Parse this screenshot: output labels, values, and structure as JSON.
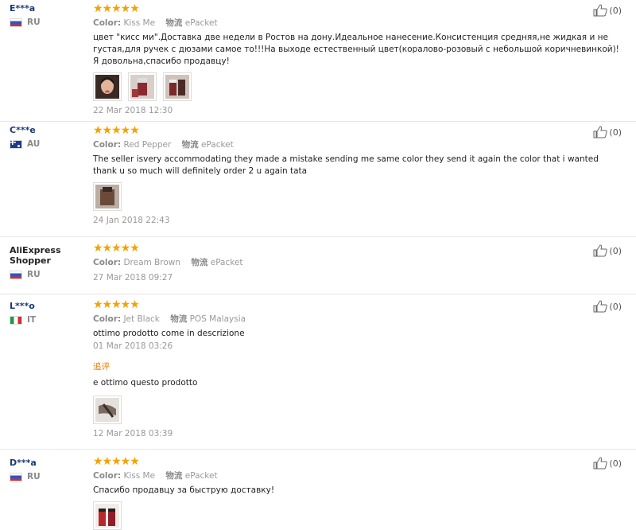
{
  "labels": {
    "color": "Color:",
    "shipping": "物流",
    "additional": "追评"
  },
  "reviews": [
    {
      "user": "E***a",
      "country": "RU",
      "stars": "★★★★★",
      "color": "Kiss Me",
      "shipping": "ePacket",
      "text": "цвет \"кисс ми\".Доставка две недели в Ростов на дону.Идеальное нанесение.Консистенция средняя,не жидкая и не густая,для ручек с дюзами самое то!!!На выходе естественный цвет(коралово-розовый с небольшой коричневинкой)!Я довольна,спасибо продавцу!",
      "date": "22 Mar 2018 12:30",
      "helpful": "(0)"
    },
    {
      "user": "C***e",
      "country": "AU",
      "stars": "★★★★★",
      "color": "Red Pepper",
      "shipping": "ePacket",
      "text": "The seller isvery accommodating they made a mistake sending me same color they send it again the color that i wanted thank u so much will definitely order 2 u again tata",
      "date": "24 Jan 2018 22:43",
      "helpful": "(0)"
    },
    {
      "user": "AliExpress Shopper",
      "country": "RU",
      "stars": "★★★★★",
      "color": "Dream Brown",
      "shipping": "ePacket",
      "date": "27 Mar 2018 09:27",
      "helpful": "(0)"
    },
    {
      "user": "L***o",
      "country": "IT",
      "stars": "★★★★★",
      "color": "Jet Black",
      "shipping": "POS Malaysia",
      "text": "ottimo prodotto come in descrizione",
      "date": "01 Mar 2018 03:26",
      "additional_text": "e ottimo questo prodotto",
      "additional_date": "12 Mar 2018 03:39",
      "helpful": "(0)"
    },
    {
      "user": "D***a",
      "country": "RU",
      "stars": "★★★★★",
      "color": "Kiss Me",
      "shipping": "ePacket",
      "text": "Спасибо продавцу за быструю доставку!",
      "helpful": "(0)"
    }
  ]
}
